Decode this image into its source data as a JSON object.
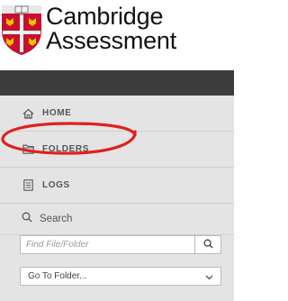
{
  "brand": {
    "line1": "Cambridge",
    "line2": "Assessment"
  },
  "nav": {
    "items": [
      {
        "label": "HOME",
        "icon": "home-icon"
      },
      {
        "label": "FOLDERS",
        "icon": "folder-icon"
      },
      {
        "label": "LOGS",
        "icon": "logs-icon"
      }
    ]
  },
  "search": {
    "heading": "Search",
    "placeholder": "Find File/Folder",
    "button_icon": "search-icon"
  },
  "folder_select": {
    "value": "Go To Folder...",
    "icon": "chevron-down-icon"
  },
  "colors": {
    "sidebar_bg": "#e4e4e4",
    "sidebar_header": "#3c3c3c",
    "annotation_red": "#e0201c",
    "shield_red": "#c8102e",
    "shield_gold": "#f2c200"
  }
}
